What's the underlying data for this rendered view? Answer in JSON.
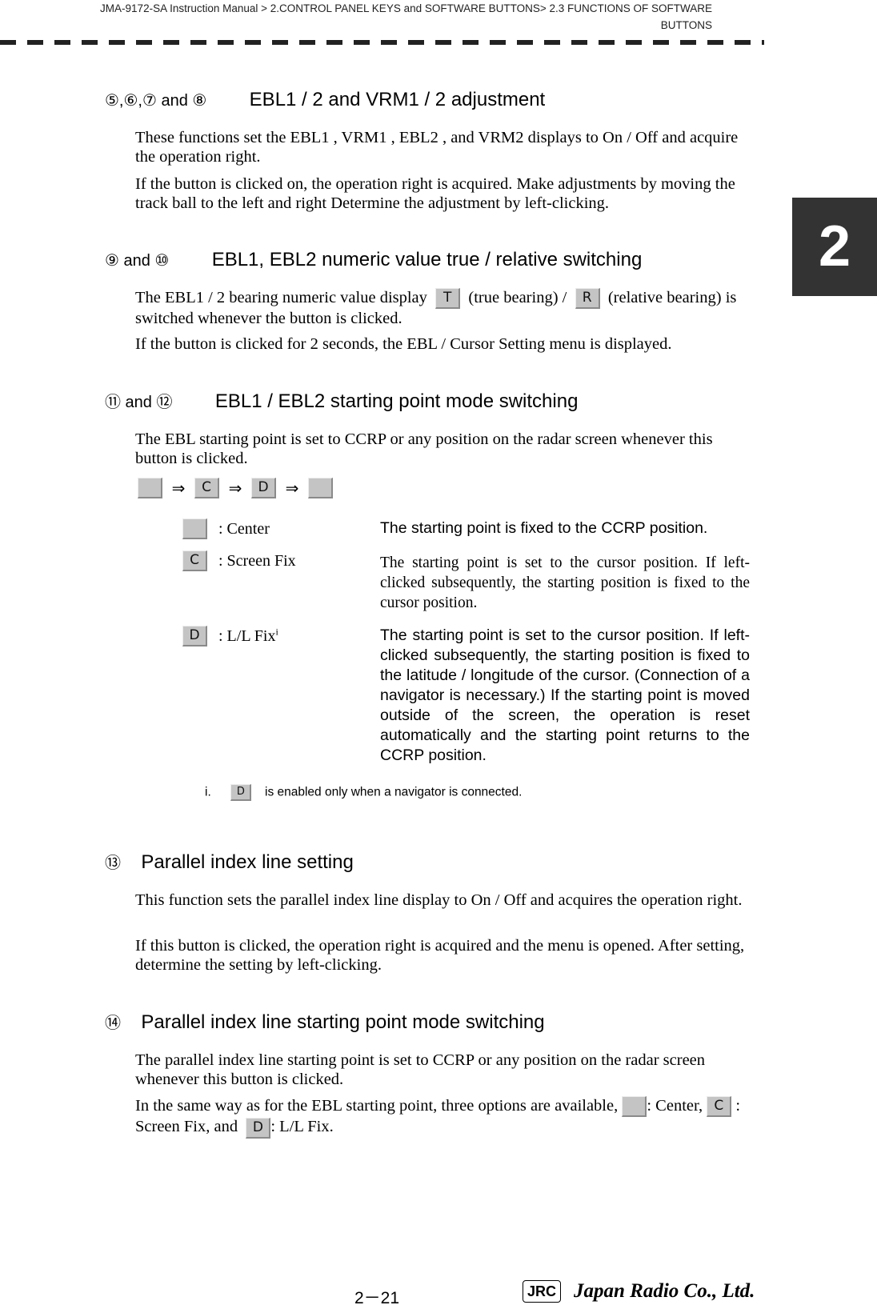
{
  "header": {
    "line1": "JMA-9172-SA Instruction Manual > 2.CONTROL PANEL KEYS and SOFTWARE BUTTONS> 2.3  FUNCTIONS OF SOFTWARE",
    "line2": "BUTTONS"
  },
  "chapter_tab": "2",
  "sections": [
    {
      "numbers": "⑤,⑥,⑦ and ⑧",
      "title": "EBL1 / 2 and VRM1 / 2 adjustment",
      "paragraphs": [
        " These functions set the  EBL1 ,  VRM1 ,  EBL2 , and  VRM2  displays to On / Off and acquire the operation right.",
        "If the button is clicked on, the operation right is acquired. Make adjustments by moving the track ball to the left and right  Determine the adjustment by left-clicking."
      ]
    },
    {
      "numbers": "⑨ and ⑩",
      "title": "EBL1, EBL2 numeric value true / relative switching",
      "p1_a": "The EBL1 / 2 bearing numeric value display",
      "btn_t": "T",
      "p1_b": "(true bearing) /",
      "btn_r": "R",
      "p1_c": "(relative bearing) is switched whenever the button is clicked.",
      "p2": "If the button is clicked for 2 seconds, the EBL / Cursor Setting menu is displayed."
    },
    {
      "numbers": "⑪ and ⑫",
      "title": "EBL1 / EBL2 starting point mode switching",
      "p1": "The EBL starting point is set to CCRP or any position on the radar screen whenever this button is clicked.",
      "sequence": [
        "",
        "C",
        "D",
        ""
      ],
      "arrow": "⇒",
      "options": [
        {
          "button": "",
          "label": ": Center",
          "description": "The starting point is fixed to the CCRP position."
        },
        {
          "button": "C",
          "label": ": Screen Fix",
          "description": "The starting point is set to the cursor position. If left-clicked subsequently, the starting position is fixed to the cursor position."
        },
        {
          "button": "D",
          "label": ": L/L Fix",
          "footnote_mark": "i",
          "description": "The starting point is set to the cursor position. If left-clicked subsequently, the starting position is fixed to the latitude / longitude of the cursor. (Connection of a navigator is necessary.) If the starting point is moved outside of the screen, the operation is reset automatically and the starting point returns to the CCRP position."
        }
      ],
      "footnote": {
        "mark": "i.",
        "button": "D",
        "text": "is enabled only when a navigator is connected."
      }
    },
    {
      "numbers": "⑬",
      "title": "Parallel index line setting",
      "paragraphs": [
        "This function sets the parallel index line display to On / Off and acquires the operation right.",
        "If this button is clicked, the operation right is acquired and the menu is opened. After setting, determine the setting by left-clicking."
      ]
    },
    {
      "numbers": "⑭",
      "title": "Parallel index line starting point mode switching",
      "p1": "The parallel index line starting point is set to CCRP or any position on the radar screen whenever this button is clicked.",
      "p2_a": "In the same way as for the EBL starting point, three options are available,",
      "btn_center": "",
      "p2_b": ": Center,",
      "btn_c": "C",
      "p2_c": ": Screen Fix, and",
      "btn_d": "D",
      "p2_d": ": L/L Fix."
    }
  ],
  "footer": {
    "page_number": "2－21",
    "logo_mark": "JRC",
    "company": "Japan Radio Co., Ltd."
  }
}
